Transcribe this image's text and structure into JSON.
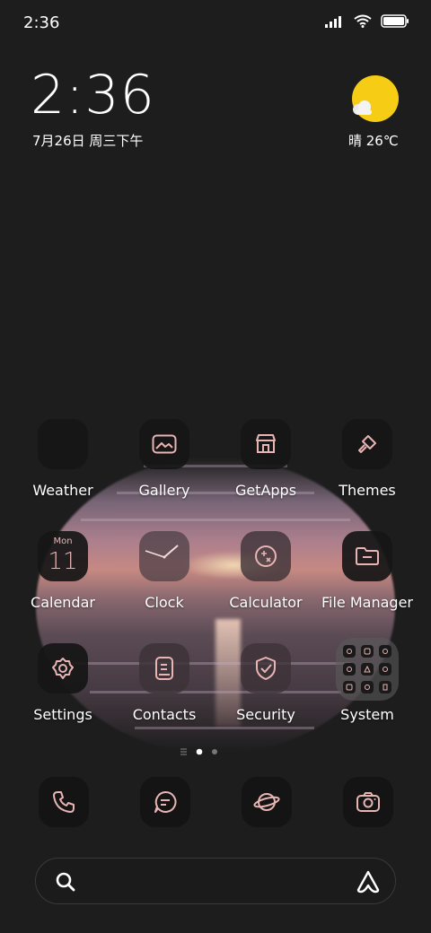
{
  "status_bar": {
    "time": "2:36",
    "icons": [
      "signal-icon",
      "wifi-icon",
      "battery-icon"
    ]
  },
  "clock_widget": {
    "time": "2:36",
    "date": "7月26日 周三下午"
  },
  "weather_widget": {
    "text": "晴 26℃",
    "icon": "sunny-partly-cloudy-icon"
  },
  "apps": [
    {
      "label": "Weather",
      "icon": "weather-icon"
    },
    {
      "label": "Gallery",
      "icon": "gallery-icon"
    },
    {
      "label": "GetApps",
      "icon": "store-icon"
    },
    {
      "label": "Themes",
      "icon": "brush-icon"
    },
    {
      "label": "Calendar",
      "icon": "calendar-icon",
      "month": "Mon",
      "day": "11"
    },
    {
      "label": "Clock",
      "icon": "clock-icon"
    },
    {
      "label": "Calculator",
      "icon": "calculator-icon"
    },
    {
      "label": "File Manager",
      "icon": "folder-icon"
    },
    {
      "label": "Settings",
      "icon": "gear-icon"
    },
    {
      "label": "Contacts",
      "icon": "contacts-icon"
    },
    {
      "label": "Security",
      "icon": "shield-icon"
    },
    {
      "label": "System",
      "icon": "folder-grid-icon"
    }
  ],
  "page_indicator": {
    "pages": 2,
    "current": 1,
    "menu_icon": "list-icon"
  },
  "dock": [
    "phone-icon",
    "messages-icon",
    "browser-icon",
    "camera-icon"
  ],
  "search_bar": {
    "left_icon": "search-icon",
    "right_icon": "assistant-icon"
  },
  "accent_color": "#e8b4b4"
}
